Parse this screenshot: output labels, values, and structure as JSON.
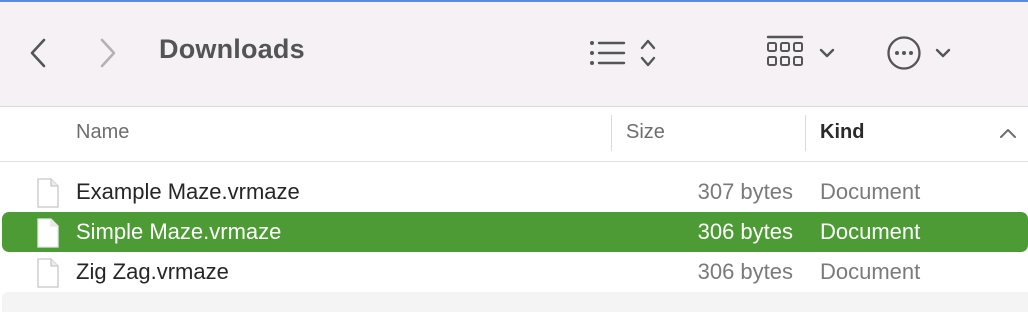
{
  "window": {
    "title": "Downloads"
  },
  "toolbar": {
    "back_icon": "chevron-left-icon",
    "forward_icon": "chevron-right-icon",
    "view_icon": "list-view-icon",
    "group_icon": "grid-group-icon",
    "more_icon": "ellipsis-circle-icon"
  },
  "columns": {
    "name": "Name",
    "size": "Size",
    "kind": "Kind",
    "sort_indicator": "ascending"
  },
  "files": [
    {
      "name": "Example Maze.vrmaze",
      "size": "307 bytes",
      "kind": "Document",
      "selected": false
    },
    {
      "name": "Simple Maze.vrmaze",
      "size": "306 bytes",
      "kind": "Document",
      "selected": true
    },
    {
      "name": "Zig Zag.vrmaze",
      "size": "306 bytes",
      "kind": "Document",
      "selected": false
    }
  ],
  "colors": {
    "selection": "#4d9b35",
    "toolbar_bg": "#f5f1f5"
  }
}
